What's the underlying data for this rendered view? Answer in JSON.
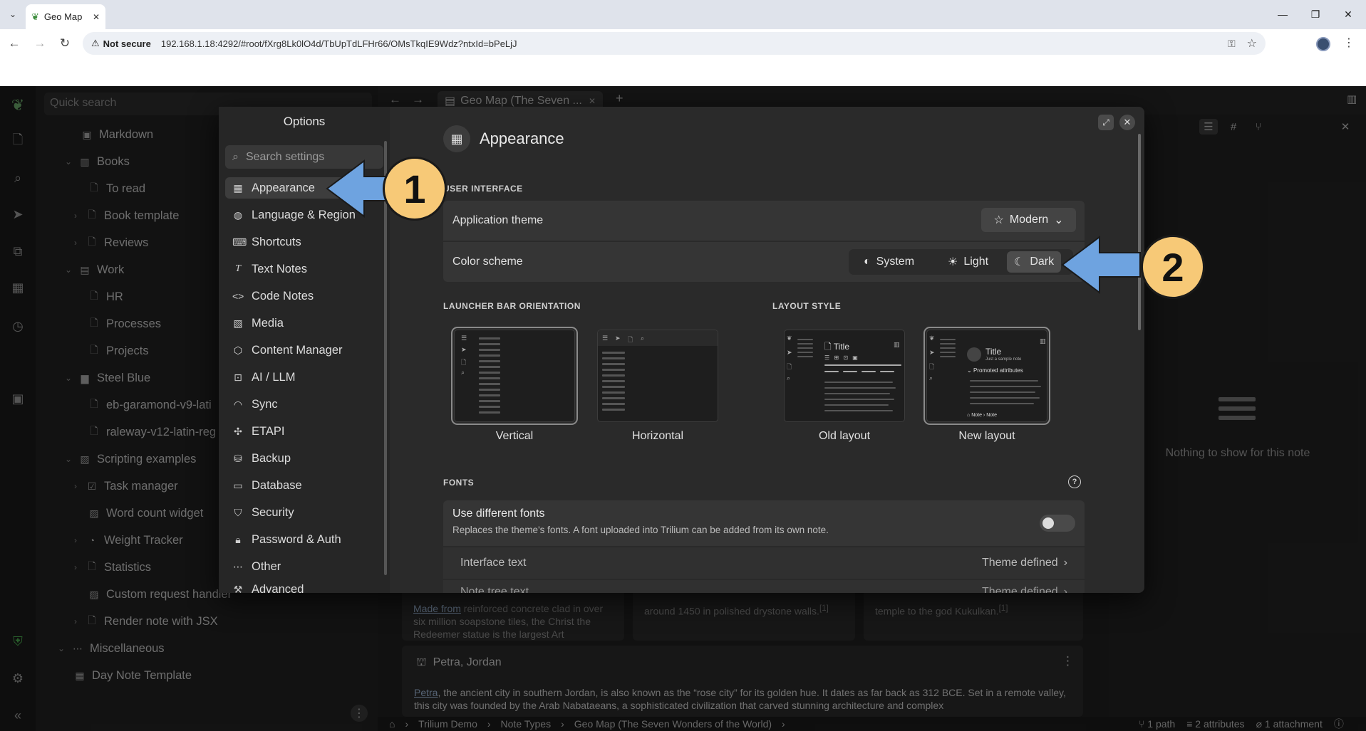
{
  "browser": {
    "tab_title": "Geo Map",
    "not_secure": "Not secure",
    "url": "192.168.1.18:4292/#root/fXrg8Lk0lO4d/TbUpTdLFHr66/OMsTkqIE9Wdz?ntxId=bPeLjJ"
  },
  "app": {
    "quick_search_placeholder": "Quick search",
    "tree": [
      {
        "label": "Markdown",
        "icon": "book-icon"
      },
      {
        "label": "Books",
        "icon": "book-open-icon"
      },
      {
        "label": "To read",
        "icon": "note-icon"
      },
      {
        "label": "Book template",
        "icon": "note-icon"
      },
      {
        "label": "Reviews",
        "icon": "note-icon"
      },
      {
        "label": "Work",
        "icon": "briefcase-icon"
      },
      {
        "label": "HR",
        "icon": "note-icon"
      },
      {
        "label": "Processes",
        "icon": "note-icon"
      },
      {
        "label": "Projects",
        "icon": "note-icon"
      },
      {
        "label": "Steel Blue",
        "icon": "file-icon"
      },
      {
        "label": "eb-garamond-v9-lati",
        "icon": "note-icon"
      },
      {
        "label": "raleway-v12-latin-reg",
        "icon": "note-icon"
      },
      {
        "label": "Scripting examples",
        "icon": "code-icon"
      },
      {
        "label": "Task manager",
        "icon": "check-icon"
      },
      {
        "label": "Word count widget",
        "icon": "code-icon"
      },
      {
        "label": "Weight Tracker",
        "icon": "gauge-icon"
      },
      {
        "label": "Statistics",
        "icon": "note-icon"
      },
      {
        "label": "Custom request handler",
        "icon": "code-icon"
      },
      {
        "label": "Render note with JSX",
        "icon": "note-icon"
      },
      {
        "label": "Miscellaneous",
        "icon": "dots-icon"
      },
      {
        "label": "Day Note Template",
        "icon": "calendar-icon"
      }
    ],
    "open_tab": "Geo Map (The Seven ...",
    "cards": {
      "card1_link": "Made from",
      "card1_text": " reinforced concrete clad in over six million soapstone tiles, the Christ the Redeemer statue is the largest Art",
      "card2_text": "around 1450 in polished drystone walls.",
      "card3_text": "temple to the god Kukulkan.",
      "footnote": "[1]"
    },
    "petra": {
      "title": "Petra, Jordan",
      "link": "Petra",
      "text": ", the ancient city in southern Jordan, is also known as the “rose city” for its golden hue. It dates as far back as 312 BCE. Set in a remote valley, this city was founded by the Arab Nabataeans, a sophisticated civilization that carved stunning architecture and complex"
    },
    "right_panel_empty": "Nothing to show for this note",
    "breadcrumb": [
      "Trilium Demo",
      "Note Types",
      "Geo Map (The Seven Wonders of the World)"
    ],
    "status": {
      "paths": "1 path",
      "attributes": "2 attributes",
      "attachments": "1 attachment"
    }
  },
  "dialog": {
    "title": "Options",
    "search_placeholder": "Search settings",
    "menu": [
      {
        "label": "Appearance",
        "icon": "layout-icon",
        "active": true
      },
      {
        "label": "Language & Region",
        "icon": "globe-icon"
      },
      {
        "label": "Shortcuts",
        "icon": "keyboard-icon"
      },
      {
        "label": "Text Notes",
        "icon": "text-icon"
      },
      {
        "label": "Code Notes",
        "icon": "code-icon"
      },
      {
        "label": "Media",
        "icon": "image-icon"
      },
      {
        "label": "Content Manager",
        "icon": "package-icon"
      },
      {
        "label": "AI / LLM",
        "icon": "robot-icon"
      },
      {
        "label": "Sync",
        "icon": "wifi-icon"
      },
      {
        "label": "ETAPI",
        "icon": "puzzle-icon"
      },
      {
        "label": "Backup",
        "icon": "database-icon"
      },
      {
        "label": "Database",
        "icon": "drive-icon"
      },
      {
        "label": "Security",
        "icon": "shield-icon"
      },
      {
        "label": "Password & Auth",
        "icon": "lock-icon"
      },
      {
        "label": "Other",
        "icon": "dots-icon"
      },
      {
        "label": "Advanced",
        "icon": "wrench-icon"
      }
    ],
    "header": "Appearance",
    "ui_section": "USER INTERFACE",
    "app_theme_label": "Application theme",
    "app_theme_value": "Modern",
    "color_scheme_label": "Color scheme",
    "color_scheme_options": [
      "System",
      "Light",
      "Dark"
    ],
    "color_scheme_selected": "Dark",
    "launcher_section": "LAUNCHER BAR ORIENTATION",
    "launcher_options": [
      "Vertical",
      "Horizontal"
    ],
    "launcher_selected": "Vertical",
    "layout_section": "LAYOUT STYLE",
    "layout_options": [
      "Old layout",
      "New layout"
    ],
    "layout_selected": "New layout",
    "layout_thumb_title": "Title",
    "layout_thumb_subtitle": "Just a sample note",
    "layout_thumb_promoted": "Promoted attributes",
    "layout_thumb_breadcrumb": "Note › Note",
    "fonts_section": "FONTS",
    "use_fonts_title": "Use different fonts",
    "use_fonts_desc": "Replaces the theme's fonts. A font uploaded into Trilium can be added from its own note.",
    "use_fonts_enabled": false,
    "interface_text_label": "Interface text",
    "interface_text_value": "Theme defined",
    "note_tree_label": "Note tree text",
    "note_tree_value": "Theme defined"
  },
  "callouts": [
    "1",
    "2"
  ],
  "colors": {
    "accent_callout": "#f7c977",
    "arrow": "#6ea3e0"
  }
}
